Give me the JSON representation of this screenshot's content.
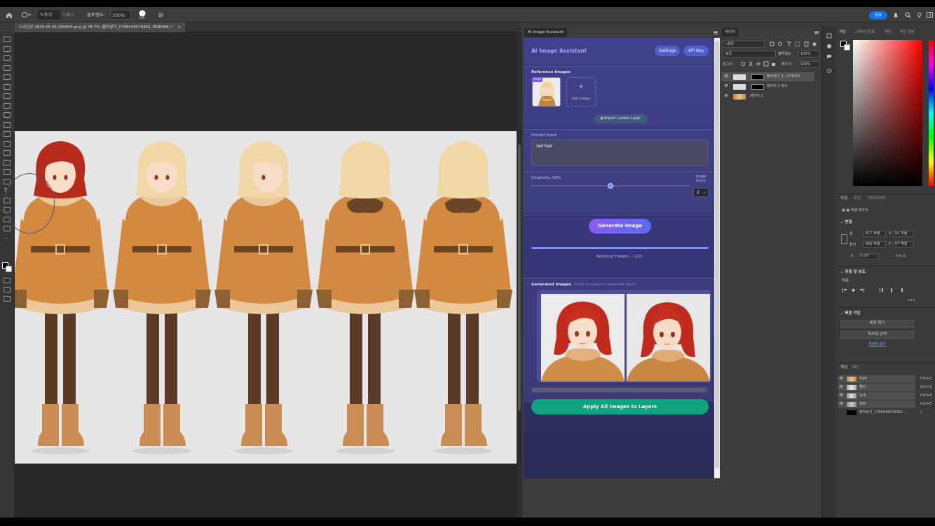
{
  "options_bar": {
    "brush_mode_active": "추가",
    "brush_mode_2": "빼기",
    "opacity_label": "불투명도:",
    "opacity_value": "100%",
    "brush_size": "209"
  },
  "top_right": {
    "share_label": "공유"
  },
  "document": {
    "tab_title": "스크린샷 2025-05-05 205859.png @ 74.7% (붙여넣기_1758449578351, RGB/8#) *",
    "close": "×"
  },
  "ai_panel": {
    "tab_label": "AI Image Assistant",
    "title": "AI Image Assistant",
    "settings_label": "Settings",
    "api_key_label": "API Key",
    "reference_label": "Reference Images",
    "ref_badge": "img1",
    "add_image_plus": "+",
    "add_image_label": "Add Image",
    "import_layer_label": "Import Current Layer",
    "prompt_label": "Prompt Input",
    "prompt_value": "red hair",
    "creativity_label": "Creativity: 50%",
    "creativity_value": 0.5,
    "image_count_label": "Image\nCount",
    "image_count_value": "2",
    "generate_label": "Generate Image",
    "progress_value": 1.0,
    "status_text": "Applying images... (2/2)",
    "generated_label": "Generated Images",
    "generated_hint": "(Click to paste to selected layer)",
    "apply_label": "Apply All Images to Layers",
    "colors": {
      "accent_purple": "#8b5cf6",
      "accent_blue": "#5b6cf0",
      "apply_green": "#10a37f",
      "settings_btn": "#4d5fcf"
    }
  },
  "layers_panel": {
    "tab_label": "레이어",
    "filter_label": "종류",
    "blend_mode": "표준",
    "opacity_label": "불투명도:",
    "opacity_value": "100%",
    "lock_label": "잠그기:",
    "fill_label": "채우기:",
    "fill_value": "100%",
    "layers": [
      {
        "name": "붙여넣기_1...578351"
      },
      {
        "name": "레이어 1 복사"
      },
      {
        "name": "레이어 1"
      }
    ]
  },
  "color_panel": {
    "tabs": [
      "색상",
      "그레이디언트",
      "패턴",
      "색상 견본"
    ],
    "base_hex": "#ff0000"
  },
  "properties_panel": {
    "tabs": [
      "속성",
      "조정",
      "라이브러리"
    ],
    "type_label": "픽셀 레이어",
    "transform_label": "변형",
    "w_label": "폭",
    "w_value": "417 픽셀",
    "x_label": "X",
    "x_value": "64 픽셀",
    "h_label": "높이",
    "h_value": "452 픽셀",
    "y_label": "Y",
    "y_value": "67 픽셀",
    "angle_value": "0.00°",
    "align_label": "맞춤 및 분포",
    "align_sub": "맞춤:",
    "quick_label": "빠른 작업",
    "quick_btn_1": "배경 제거",
    "quick_btn_2": "피사체 선택",
    "more_link": "자세히 보기"
  },
  "channels_panel": {
    "tabs": [
      "채널",
      "패스"
    ],
    "channels": [
      {
        "name": "RGB",
        "shortcut": "Ctrl+2"
      },
      {
        "name": "빨강",
        "shortcut": "Ctrl+3"
      },
      {
        "name": "녹색",
        "shortcut": "Ctrl+4"
      },
      {
        "name": "파랑",
        "shortcut": "Ctrl+5"
      },
      {
        "name": "붙여넣기_1758449578351 ...",
        "shortcut": "\\"
      }
    ]
  }
}
